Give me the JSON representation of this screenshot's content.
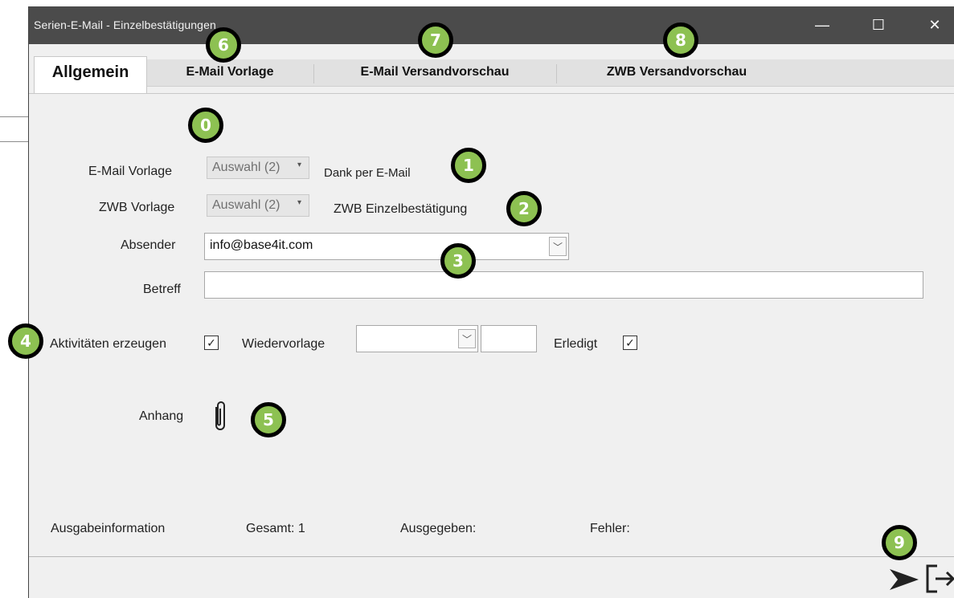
{
  "window": {
    "title": "Serien-E-Mail - Einzelbestätigungen",
    "minimize": "—",
    "maximize": "☐",
    "close": "✕"
  },
  "tabs": [
    {
      "label": "Allgemein"
    },
    {
      "label": "E-Mail Vorlage"
    },
    {
      "label": "E-Mail Versandvorschau"
    },
    {
      "label": "ZWB Versandvorschau"
    }
  ],
  "form": {
    "email_template_label": "E-Mail Vorlage",
    "email_template_select": "Auswahl (2)",
    "email_template_value": "Dank per E-Mail",
    "zwb_template_label": "ZWB Vorlage",
    "zwb_template_select": "Auswahl (2)",
    "zwb_template_value": "ZWB Einzelbestätigung",
    "sender_label": "Absender",
    "sender_value": "info@base4it.com",
    "subject_label": "Betreff",
    "subject_value": "",
    "activities_label": "Aktivitäten erzeugen",
    "activities_checked": true,
    "followup_label": "Wiedervorlage",
    "followup_value": "",
    "followup_number": "",
    "done_label": "Erledigt",
    "done_checked": true,
    "attachment_label": "Anhang",
    "check_mark": "✓",
    "dropdown_arrow": "▾",
    "combo_arrow": "﹀"
  },
  "status": {
    "output_info_label": "Ausgabeinformation",
    "total": "Gesamt: 1",
    "issued": "Ausgegeben:",
    "errors": "Fehler:"
  },
  "badges": [
    "0",
    "1",
    "2",
    "3",
    "4",
    "5",
    "6",
    "7",
    "8",
    "9"
  ],
  "icons": {
    "attachment": "paperclip-icon",
    "send": "send-icon",
    "exit": "exit-icon"
  },
  "colors": {
    "titlebar": "#4b4b4b",
    "badge_fill": "#8dc152",
    "badge_border": "#000000"
  }
}
